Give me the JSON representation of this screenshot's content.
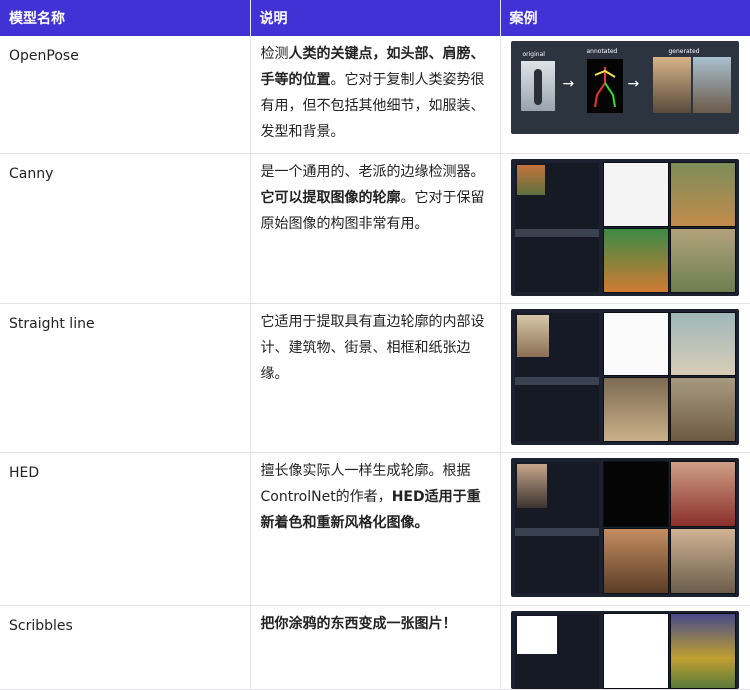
{
  "table": {
    "headers": [
      "模型名称",
      "说明",
      "案例"
    ],
    "rows": [
      {
        "name": "OpenPose",
        "desc": [
          {
            "t": "检测"
          },
          {
            "t": "人类的关键点，如头部、肩膀、手等的位置",
            "b": true
          },
          {
            "t": "。它对于复制人类姿势很有用，但不包括其他细节，如服装、发型和背景。"
          }
        ],
        "image": {
          "labels": [
            "original",
            "annotated",
            "generated"
          ]
        }
      },
      {
        "name": "Canny",
        "desc": [
          {
            "t": "是一个通用的、老派的边缘检测器。"
          },
          {
            "t": "它可以提取图像的轮廓",
            "b": true
          },
          {
            "t": "。它对于保留原始图像的构图非常有用。"
          }
        ]
      },
      {
        "name": "Straight line",
        "desc": [
          {
            "t": "它适用于提取具有直边轮廓的内部设计、建筑物、街景、相框和纸张边缘。"
          }
        ]
      },
      {
        "name": "HED",
        "desc": [
          {
            "t": "擅长像实际人一样生成轮廓。根据ControlNet的作者，"
          },
          {
            "t": "HED适用于重新着色和重新风格化图像。",
            "b": true
          }
        ]
      },
      {
        "name": "Scribbles",
        "desc": [
          {
            "t": "把你涂鸦的东西变成一张图片！",
            "b": true
          }
        ]
      }
    ]
  },
  "colors": {
    "header_bg": "#4132d6",
    "header_text": "#ffffff"
  }
}
